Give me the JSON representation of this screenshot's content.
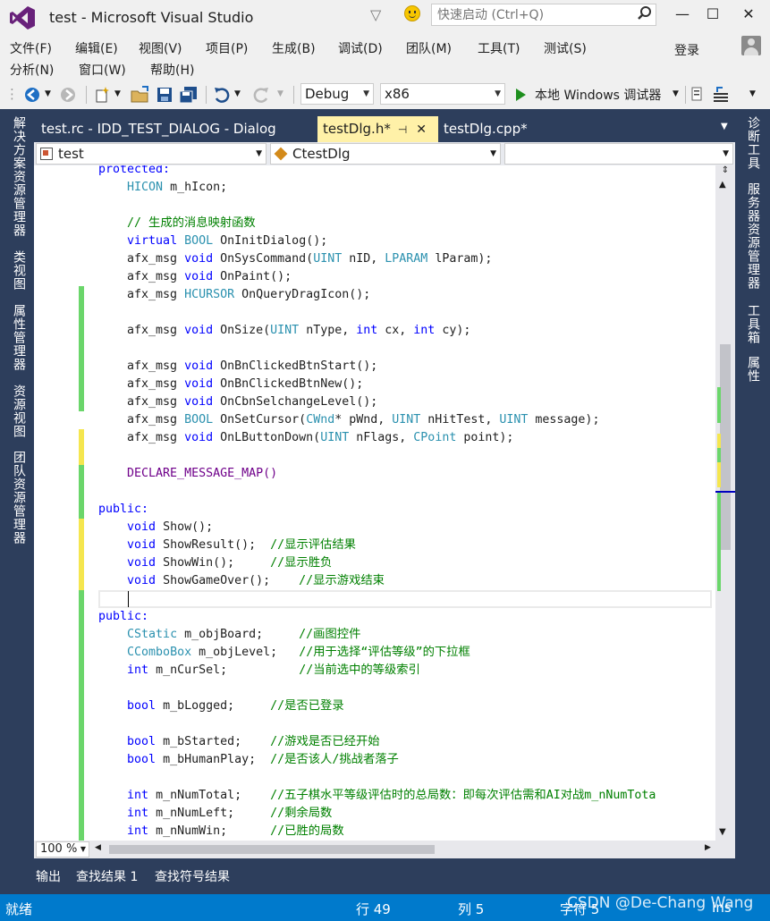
{
  "window": {
    "title": "test - Microsoft Visual Studio",
    "quick_launch_placeholder": "快速启动 (Ctrl+Q)",
    "minimize": "—",
    "maximize": "☐",
    "close": "✕"
  },
  "menu": {
    "row1": [
      "文件(F)",
      "编辑(E)",
      "视图(V)",
      "项目(P)",
      "生成(B)",
      "调试(D)",
      "团队(M)",
      "工具(T)",
      "测试(S)"
    ],
    "row2": [
      "分析(N)",
      "窗口(W)",
      "帮助(H)"
    ],
    "login": "登录"
  },
  "toolbar": {
    "config": "Debug",
    "platform": "x86",
    "run_label": "本地 Windows 调试器"
  },
  "left_panel_tabs": [
    "解决方案资源管理器",
    "类视图",
    "属性管理器",
    "资源视图",
    "团队资源管理器"
  ],
  "right_panel_tabs": [
    "诊断工具",
    "服务器资源管理器",
    "工具箱",
    "属性"
  ],
  "doc_tabs": {
    "tab1": "test.rc - IDD_TEST_DIALOG - Dialog",
    "tab2": "testDlg.h*",
    "tab3": "testDlg.cpp*"
  },
  "nav": {
    "project": "test",
    "class": "CtestDlg",
    "member": ""
  },
  "code_lines": [
    "protected:",
    "    HICON m_hIcon;",
    "",
    "    // 生成的消息映射函数",
    "    virtual BOOL OnInitDialog();",
    "    afx_msg void OnSysCommand(UINT nID, LPARAM lParam);",
    "    afx_msg void OnPaint();",
    "    afx_msg HCURSOR OnQueryDragIcon();",
    "",
    "    afx_msg void OnSize(UINT nType, int cx, int cy);",
    "",
    "    afx_msg void OnBnClickedBtnStart();",
    "    afx_msg void OnBnClickedBtnNew();",
    "    afx_msg void OnCbnSelchangeLevel();",
    "    afx_msg BOOL OnSetCursor(CWnd* pWnd, UINT nHitTest, UINT message);",
    "    afx_msg void OnLButtonDown(UINT nFlags, CPoint point);",
    "",
    "    DECLARE_MESSAGE_MAP()",
    "",
    "public:",
    "    void Show();",
    "    void ShowResult();  //显示评估结果",
    "    void ShowWin();     //显示胜负",
    "    void ShowGameOver();    //显示游戏结束",
    "",
    "public:",
    "    CStatic m_objBoard;     //画图控件",
    "    CComboBox m_objLevel;   //用于选择“评估等级”的下拉框",
    "    int m_nCurSel;          //当前选中的等级索引",
    "",
    "    bool m_bLogged;     //是否已登录",
    "",
    "    bool m_bStarted;    //游戏是否已经开始",
    "    bool m_bHumanPlay;  //是否该人/挑战者落子",
    "",
    "    int m_nNumTotal;    //五子棋水平等级评估时的总局数：即每次评估需和AI对战m_nNumTota",
    "    int m_nNumLeft;     //剩余局数",
    "    int m_nNumWin;      //已胜的局数"
  ],
  "editor_footer": {
    "zoom": "100 %"
  },
  "bottom_tabs": [
    "输出",
    "查找结果 1",
    "查找符号结果"
  ],
  "status": {
    "ready": "就绪",
    "line": "行 49",
    "col": "列 5",
    "char": "字符 5",
    "mode": "Ins",
    "watermark": "CSDN @De-Chang Wang"
  }
}
